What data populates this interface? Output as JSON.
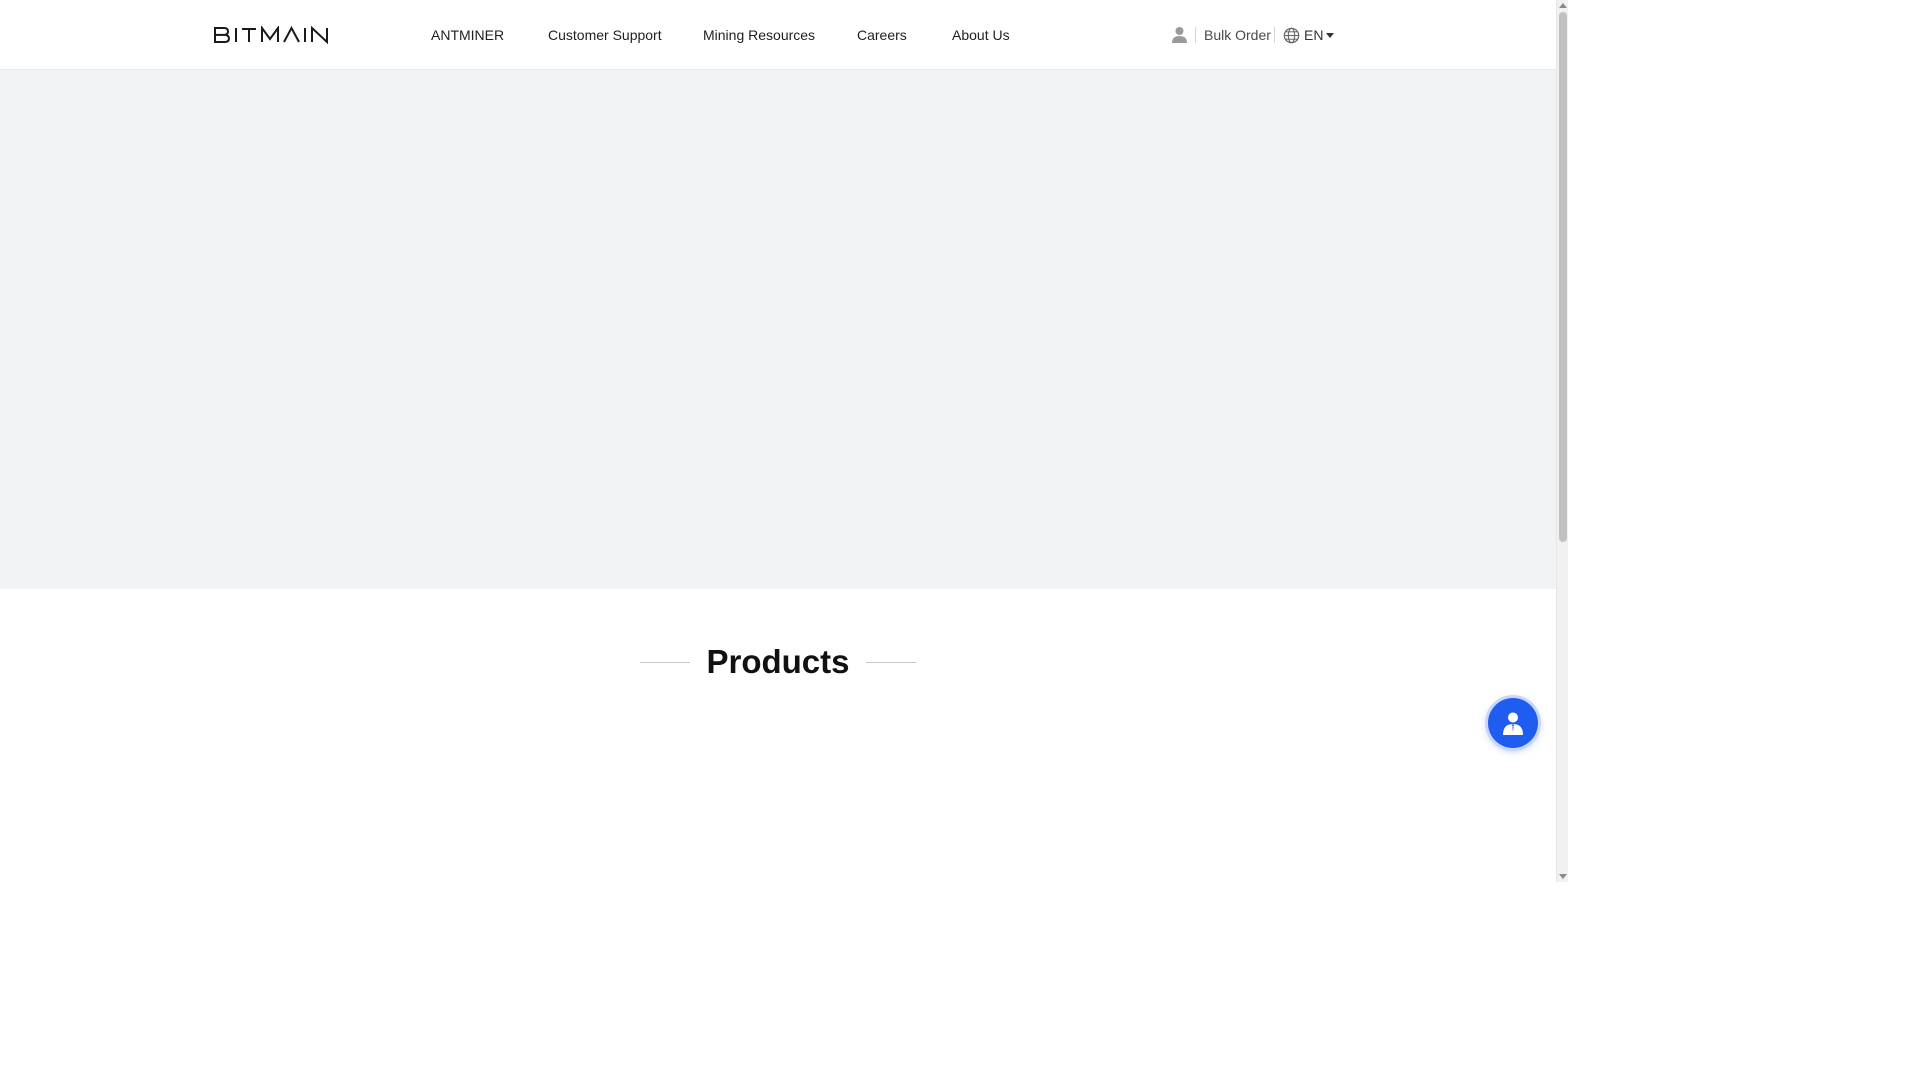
{
  "header": {
    "logo_text": "BITMAIN",
    "nav": [
      {
        "label": "ANTMINER"
      },
      {
        "label": "Customer Support"
      },
      {
        "label": "Mining Resources"
      },
      {
        "label": "Careers"
      },
      {
        "label": "About Us"
      }
    ],
    "bulk_order_label": "Bulk Order",
    "language": "EN"
  },
  "sections": {
    "products_title": "Products"
  },
  "icons": {
    "user": "user-icon",
    "globe": "globe-icon",
    "caret": "caret-down-icon",
    "support": "customer-service-icon"
  },
  "colors": {
    "accent": "#1f5cf0",
    "hero_bg": "#f2f3f5",
    "text": "#1f1f1f"
  }
}
